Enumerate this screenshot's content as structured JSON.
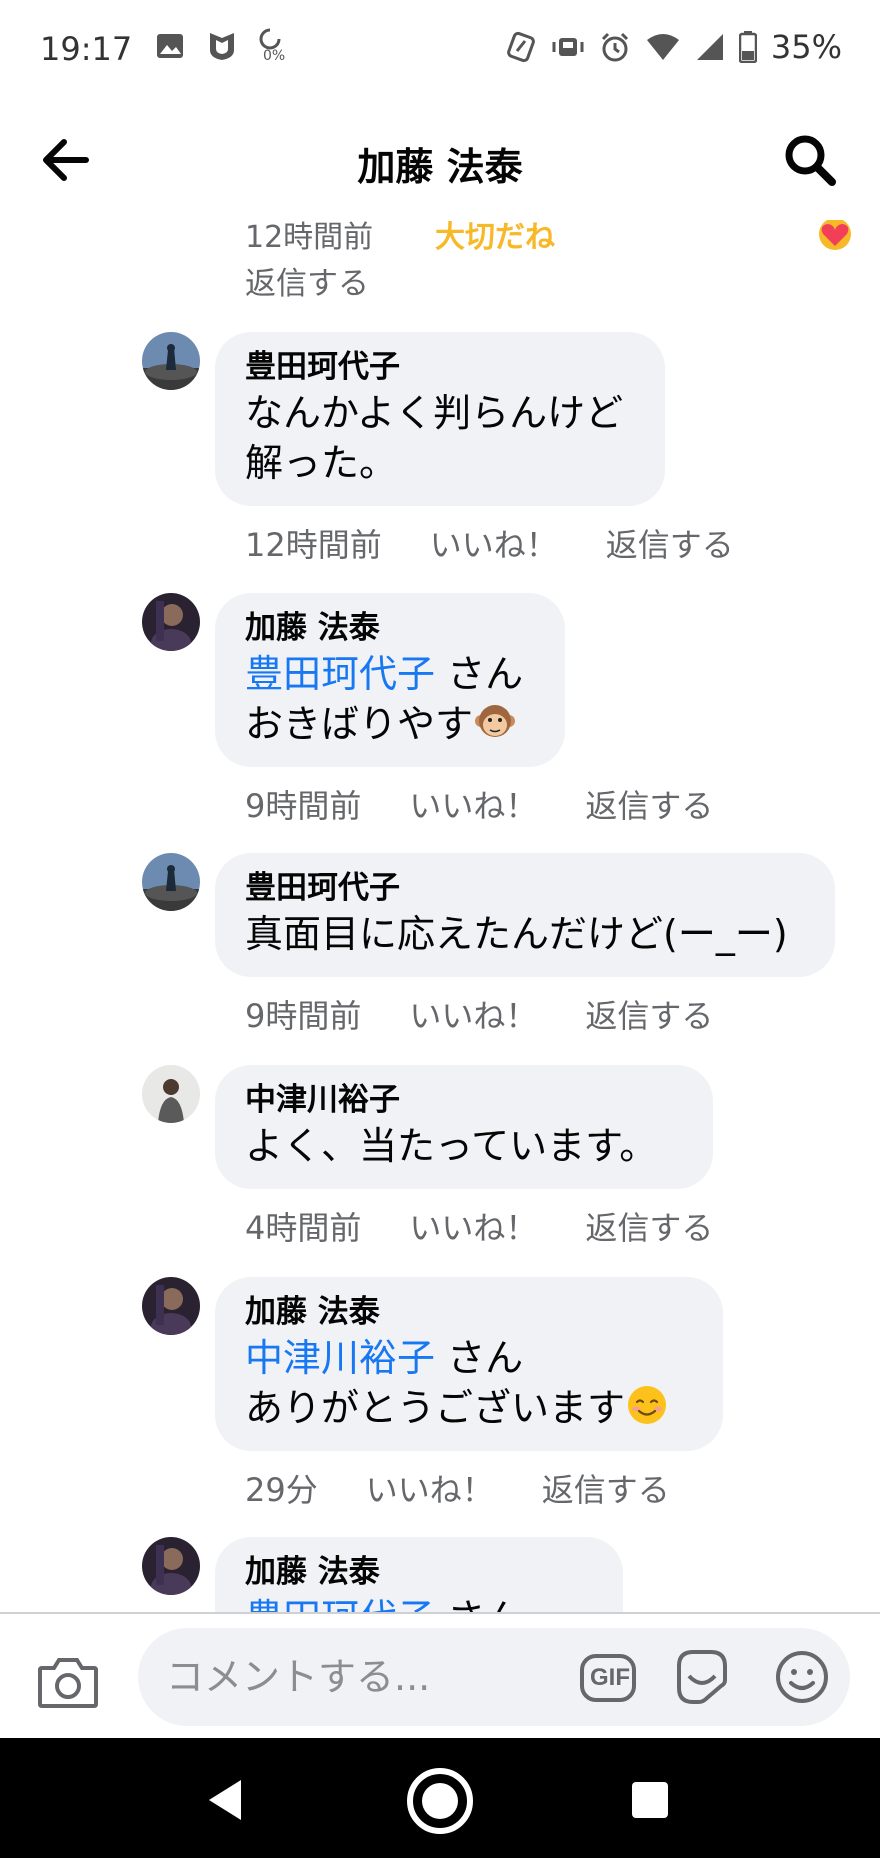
{
  "status_bar": {
    "time": "19:17",
    "battery_text": "35%",
    "left_icons": [
      "image-icon",
      "shield-icon",
      "data-saver-icon"
    ],
    "right_icons": [
      "nfc-icon",
      "vibrate-icon",
      "alarm-icon",
      "wifi-icon",
      "signal-icon",
      "battery-icon"
    ],
    "data_saver_text": "0%"
  },
  "header": {
    "title": "加藤 法泰",
    "back_icon": "arrow-left-icon",
    "search_icon": "search-icon"
  },
  "partial_top": {
    "time": "12時間前",
    "like_label": "大切だね",
    "reply_label": "返信する"
  },
  "comments": [
    {
      "author": "豊田珂代子",
      "lines": [
        "なんかよく判らんけど",
        "解った。"
      ],
      "time": "12時間前",
      "like_label": "いいね！",
      "reply_label": "返信する"
    },
    {
      "author": "加藤 法泰",
      "mention": "豊田珂代子",
      "mention_suffix": " さん",
      "line2": "おきばりやす",
      "emoji": "monkey-face-emoji",
      "time": "9時間前",
      "like_label": "いいね！",
      "reply_label": "返信する"
    },
    {
      "author": "豊田珂代子",
      "lines": [
        "真面目に応えたんだけど(ー_ー)"
      ],
      "time": "9時間前",
      "like_label": "いいね！",
      "reply_label": "返信する"
    },
    {
      "author": "中津川裕子",
      "lines": [
        "よく、当たっています。"
      ],
      "time": "4時間前",
      "like_label": "いいね！",
      "reply_label": "返信する"
    },
    {
      "author": "加藤 法泰",
      "mention": "中津川裕子",
      "mention_suffix": " さん",
      "line2": "ありがとうございます",
      "emoji": "smiling-face-emoji",
      "time": "29分",
      "like_label": "いいね！",
      "reply_label": "返信する"
    },
    {
      "author": "加藤 法泰",
      "mention": "豊田珂代子",
      "mention_suffix": " さん"
    }
  ],
  "composer": {
    "placeholder": "コメントする...",
    "camera_icon": "camera-icon",
    "gif_label": "GIF",
    "sticker_icon": "sticker-icon",
    "emoji_icon": "emoji-icon"
  },
  "navbar": {
    "icons": [
      "nav-back-icon",
      "nav-home-icon",
      "nav-recents-icon"
    ]
  },
  "colors": {
    "bubble": "#f0f2f5",
    "mention": "#1877f2",
    "meta": "#65676b",
    "love_reaction": "#f7b928"
  }
}
